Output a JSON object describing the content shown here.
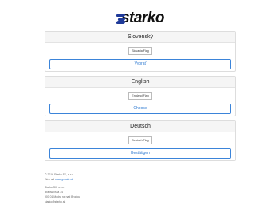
{
  "logo": {
    "text": "starko"
  },
  "languages": [
    {
      "name": "Slovenský",
      "flag_alt": "Slovakia Flag",
      "button": "Vybrať"
    },
    {
      "name": "English",
      "flag_alt": "England Flag",
      "button": "Choose"
    },
    {
      "name": "Deutsch",
      "flag_alt": "Deutsch Flag",
      "button": "Bestätigen"
    }
  ],
  "footer": {
    "copyright": "© 2016 Starko SK, s.r.o.",
    "web_prefix": "Web s/tl",
    "web_link": "www.gnsale.sk",
    "company": "Starko SK, s.r.o.",
    "street": "Bratislavská 34",
    "city": "900 01 Modra na nad Brodou",
    "email": "starko@starko.sk"
  }
}
